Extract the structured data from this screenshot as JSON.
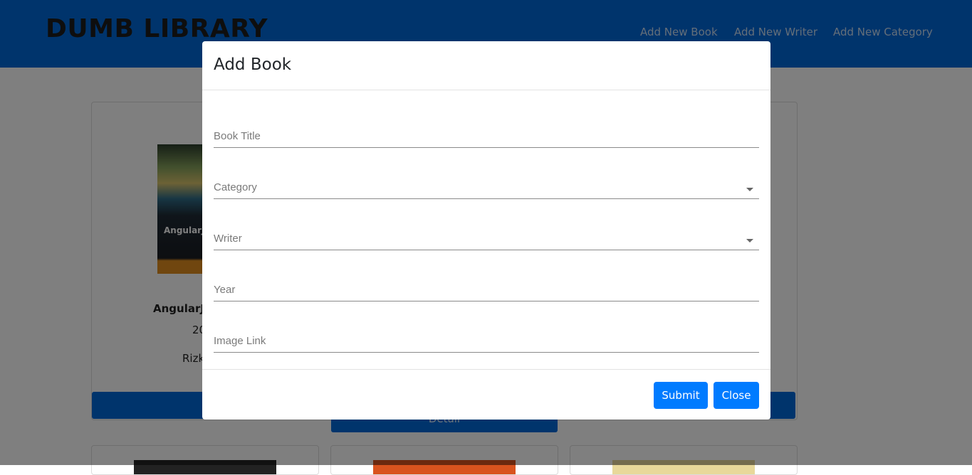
{
  "navbar": {
    "brand": "DUMB LIBRARY",
    "links": [
      "Add New Book",
      "Add New Writer",
      "Add New Category"
    ]
  },
  "background_page": {
    "book": {
      "cover_title": "AngularJS",
      "title": "AngularJs",
      "year": "20",
      "writer": "Rizk"
    },
    "detail_label_1": "De",
    "detail_label_2": "Detail"
  },
  "modal": {
    "title": "Add Book",
    "fields": [
      {
        "label": "Book Title",
        "type": "text"
      },
      {
        "label": "Category",
        "type": "select"
      },
      {
        "label": "Writer",
        "type": "select"
      },
      {
        "label": "Year",
        "type": "text"
      },
      {
        "label": "Image Link",
        "type": "text"
      }
    ],
    "submit_label": "Submit",
    "close_label": "Close"
  },
  "colors": {
    "navbar": "#0069d9",
    "primary_button": "#007bff",
    "backdrop": "rgba(0,0,0,0.5)"
  },
  "icons": {
    "select_caret": "caret-down-icon"
  }
}
